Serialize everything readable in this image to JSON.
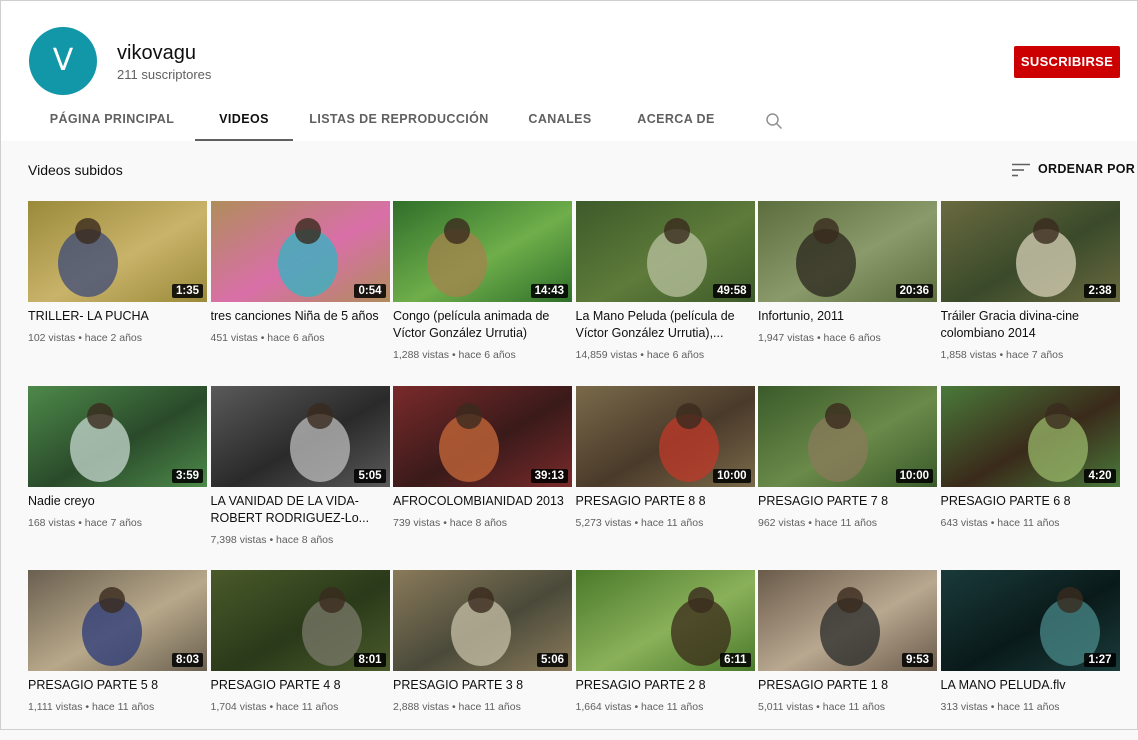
{
  "channel": {
    "avatar_letter": "V",
    "name": "vikovagu",
    "subscribers": "211 suscriptores",
    "subscribe_label": "SUSCRIBIRSE"
  },
  "tabs": [
    {
      "label": "PÁGINA PRINCIPAL"
    },
    {
      "label": "VIDEOS"
    },
    {
      "label": "LISTAS DE REPRODUCCIÓN"
    },
    {
      "label": "CANALES"
    },
    {
      "label": "ACERCA DE"
    }
  ],
  "icons": {
    "search": "search-icon",
    "sort": "sort-icon"
  },
  "section": {
    "title": "Videos subidos",
    "sort_label": "ORDENAR POR"
  },
  "colors": {
    "subscribe": "#cc0000",
    "avatar": "#1197a8"
  },
  "videos": [
    {
      "title": "TRILLER- LA PUCHA",
      "meta": "102 vistas • hace 2 años",
      "duration": "1:35",
      "palette": [
        "#9a8a3a",
        "#3c4a7a",
        "#c9b36a"
      ]
    },
    {
      "title": "tres canciones Niña de 5 años",
      "meta": "451 vistas • hace 6 años",
      "duration": "0:54",
      "palette": [
        "#b08d5a",
        "#2fb6c4",
        "#d96fa8"
      ]
    },
    {
      "title": "Congo (película animada de Víctor González Urrutia)",
      "meta": "1,288 vistas • hace 6 años",
      "duration": "14:43",
      "palette": [
        "#2f6f2a",
        "#a4824c",
        "#6fae4a"
      ]
    },
    {
      "title": "La Mano Peluda (película de Víctor González Urrutia),...",
      "meta": "14,859 vistas • hace 6 años",
      "duration": "49:58",
      "palette": [
        "#3d5a2a",
        "#b9c2a0",
        "#5e7b3a"
      ]
    },
    {
      "title": "Infortunio, 2011",
      "meta": "1,947 vistas • hace 6 años",
      "duration": "20:36",
      "palette": [
        "#5c6d3e",
        "#2a241c",
        "#8a9a6a"
      ]
    },
    {
      "title": "Tráiler Gracia divina-cine colombiano 2014",
      "meta": "1,858 vistas • hace 7 años",
      "duration": "2:38",
      "palette": [
        "#6a6a40",
        "#d8d2b8",
        "#3a4a2a"
      ]
    },
    {
      "title": "Nadie creyo",
      "meta": "168 vistas • hace 7 años",
      "duration": "3:59",
      "palette": [
        "#4d8a4a",
        "#c7d8d0",
        "#2a4a2a"
      ]
    },
    {
      "title": "LA VANIDAD DE LA VIDA- ROBERT RODRIGUEZ-Lo...",
      "meta": "7,398 vistas • hace 8 años",
      "duration": "5:05",
      "palette": [
        "#5a5a5a",
        "#bdbdbd",
        "#2a2a2a"
      ]
    },
    {
      "title": "AFROCOLOMBIANIDAD 2013",
      "meta": "739 vistas • hace 8 años",
      "duration": "39:13",
      "palette": [
        "#7a2a2a",
        "#c86a3a",
        "#3a1a1a"
      ]
    },
    {
      "title": "PRESAGIO PARTE 8 8",
      "meta": "5,273 vistas • hace 11 años",
      "duration": "10:00",
      "palette": [
        "#7a6a4a",
        "#c03a2a",
        "#4a3a2a"
      ]
    },
    {
      "title": "PRESAGIO PARTE 7 8",
      "meta": "962 vistas • hace 11 años",
      "duration": "10:00",
      "palette": [
        "#3a5a2a",
        "#8a7a5a",
        "#6a8a4a"
      ]
    },
    {
      "title": "PRESAGIO PARTE 6 8",
      "meta": "643 vistas • hace 11 años",
      "duration": "4:20",
      "palette": [
        "#4a7a3a",
        "#9ab86a",
        "#3a2a1a"
      ]
    },
    {
      "title": "PRESAGIO PARTE 5 8",
      "meta": "1,111 vistas • hace 11 años",
      "duration": "8:03",
      "palette": [
        "#6a6050",
        "#2a3a7a",
        "#b8a88a"
      ]
    },
    {
      "title": "PRESAGIO PARTE 4 8",
      "meta": "1,704 vistas • hace 11 años",
      "duration": "8:01",
      "palette": [
        "#4a5a2a",
        "#7a7a6a",
        "#2a3a1a"
      ]
    },
    {
      "title": "PRESAGIO PARTE 3 8",
      "meta": "2,888 vistas • hace 11 años",
      "duration": "5:06",
      "palette": [
        "#8a7a5a",
        "#c8c0a8",
        "#4a4a3a"
      ]
    },
    {
      "title": "PRESAGIO PARTE 2 8",
      "meta": "1,664 vistas • hace 11 años",
      "duration": "6:11",
      "palette": [
        "#4a7a2a",
        "#3a2a1a",
        "#8ab05a"
      ]
    },
    {
      "title": "PRESAGIO PARTE 1 8",
      "meta": "5,011 vistas • hace 11 años",
      "duration": "9:53",
      "palette": [
        "#6a5a4a",
        "#2a2a2a",
        "#b8a890"
      ]
    },
    {
      "title": "LA MANO PELUDA.flv",
      "meta": "313 vistas • hace 11 años",
      "duration": "1:27",
      "palette": [
        "#1a3a3a",
        "#4a8a8a",
        "#0a1a1a"
      ]
    }
  ]
}
